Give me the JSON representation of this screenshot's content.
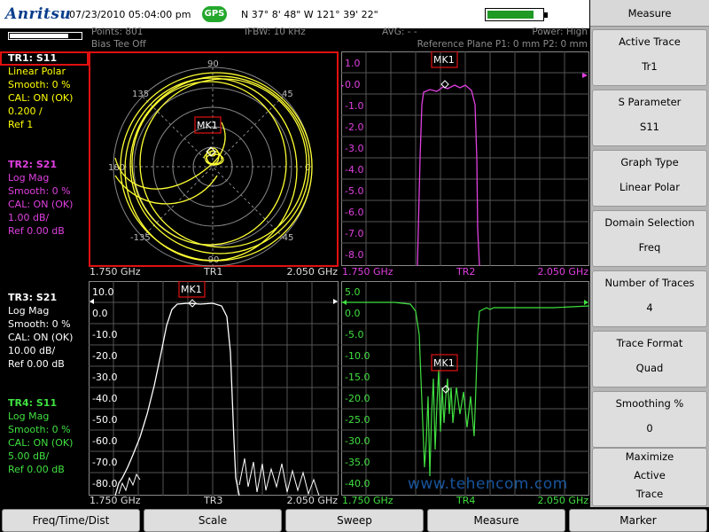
{
  "status_bar": {
    "brand": "Anritsu",
    "datetime": "07/23/2010 05:04:00 pm",
    "gps_badge": "GPS",
    "coordinates": "N 37° 8' 48\" W 121° 39' 22\"",
    "battery_level": 0.85
  },
  "info": {
    "points": "Points: 801",
    "bias_tee": "Bias Tee Off",
    "ifbw": "IFBW: 10 kHz",
    "avg": "AVG: - -",
    "power": "Power: High",
    "reference_plane": "Reference Plane P1: 0 mm P2: 0 mm",
    "scale_level": 0.82
  },
  "traces": [
    {
      "title": "TR1:",
      "param": "S11",
      "format": "Linear Polar",
      "smooth": "Smooth: 0 %",
      "cal": "CAL: ON (OK)",
      "scale": "0.200 /",
      "ref": "Ref 1",
      "color": "#ffff00",
      "active": true
    },
    {
      "title": "TR2:",
      "param": "S21",
      "format": "Log Mag",
      "smooth": "Smooth: 0 %",
      "cal": "CAL: ON (OK)",
      "scale": "1.00 dB/",
      "ref": "Ref 0.00 dB",
      "color": "#e040e0",
      "active": false
    },
    {
      "title": "TR3:",
      "param": "S21",
      "format": "Log Mag",
      "smooth": "Smooth: 0 %",
      "cal": "CAL: ON (OK)",
      "scale": "10.00 dB/",
      "ref": "Ref 0.00 dB",
      "color": "#ffffff",
      "active": false
    },
    {
      "title": "TR4:",
      "param": "S11",
      "format": "Log Mag",
      "smooth": "Smooth: 0 %",
      "cal": "CAL: ON (OK)",
      "scale": "5.00 dB/",
      "ref": "Ref 0.00 dB",
      "color": "#40e040",
      "active": false
    }
  ],
  "graphs": {
    "tr1": {
      "trace_label": "TR1",
      "start": "1.750 GHz",
      "stop": "2.050 GHz",
      "marker": "MK1",
      "angle_labels": [
        "90",
        "45",
        "0",
        "-45",
        "-90",
        "-135",
        "180",
        "135"
      ]
    },
    "tr2": {
      "trace_label": "TR2",
      "start": "1.750 GHz",
      "stop": "2.050 GHz",
      "marker": "MK1",
      "y_labels": [
        "1.0",
        "0.0",
        "-1.0",
        "-2.0",
        "-3.0",
        "-4.0",
        "-5.0",
        "-6.0",
        "-7.0",
        "-8.0"
      ]
    },
    "tr3": {
      "trace_label": "TR3",
      "start": "1.750 GHz",
      "stop": "2.050 GHz",
      "marker": "MK1",
      "y_labels": [
        "10.0",
        "0.0",
        "-10.0",
        "-20.0",
        "-30.0",
        "-40.0",
        "-50.0",
        "-60.0",
        "-70.0",
        "-80.0"
      ]
    },
    "tr4": {
      "trace_label": "TR4",
      "start": "1.750 GHz",
      "stop": "2.050 GHz",
      "marker": "MK1",
      "y_labels": [
        "5.0",
        "0.0",
        "-5.0",
        "-10.0",
        "-15.0",
        "-20.0",
        "-25.0",
        "-30.0",
        "-35.0",
        "-40.0"
      ]
    }
  },
  "softkeys": {
    "menu_title": "Measure",
    "items": [
      {
        "line1": "Active Trace",
        "line2": "Tr1"
      },
      {
        "line1": "S Parameter",
        "line2": "S11"
      },
      {
        "line1": "Graph Type",
        "line2": "Linear Polar"
      },
      {
        "line1": "Domain Selection",
        "line2": "Freq"
      },
      {
        "line1": "Number of Traces",
        "line2": "4"
      },
      {
        "line1": "Trace Format",
        "line2": "Quad"
      },
      {
        "line1": "Smoothing %",
        "line2": "0"
      }
    ],
    "maximize": {
      "line1": "Maximize",
      "line2": "Active",
      "line3": "Trace"
    }
  },
  "bottom_menu": [
    "Freq/Time/Dist",
    "Scale",
    "Sweep",
    "Measure",
    "Marker"
  ],
  "watermark": "www.tehencom.com"
}
